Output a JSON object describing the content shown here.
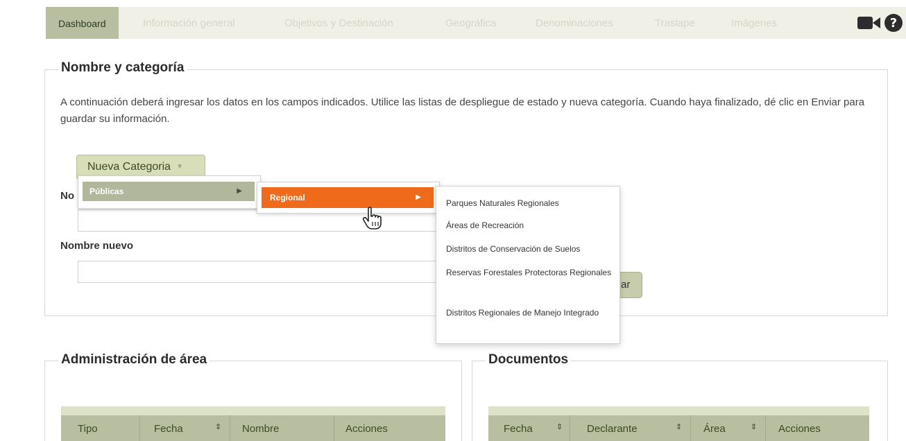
{
  "tabs": [
    {
      "label": "Dashboard",
      "active": true
    },
    {
      "label": "Información general",
      "active": false
    },
    {
      "label": "Objetivos y Destinación",
      "active": false
    },
    {
      "label": "Geográfica",
      "active": false
    },
    {
      "label": "Denominaciones",
      "active": false
    },
    {
      "label": "Traslape",
      "active": false
    },
    {
      "label": "Imágenes",
      "active": false
    }
  ],
  "toolbar": {
    "video_icon": "video-camera-icon",
    "help_icon": "help-circle-icon"
  },
  "nombre_categoria": {
    "legend": "Nombre y categoría",
    "description": "A continuación deberá ingresar los datos en los campos indicados. Utilice las listas de despliegue de estado y nueva categoría. Cuando haya finalizado, dé clic en Enviar para guardar su información.",
    "new_category_button": "Nueva Categoria",
    "nombre_label_partial": "No",
    "nombre_nuevo_label": "Nombre nuevo",
    "submit_partial": "ar"
  },
  "menu": {
    "level1": "Públicas",
    "level2": "Regional",
    "level3": [
      "Parques Naturales Regionales",
      "Áreas de Recreación",
      "Distritos de Conservación de Suelos",
      "Reservas Forestales Protectoras Regionales",
      "Distritos Regionales de Manejo Integrado"
    ]
  },
  "administracion": {
    "legend": "Administración de área",
    "columns": [
      "Tipo",
      "Fecha",
      "Nombre",
      "Acciones"
    ]
  },
  "documentos": {
    "legend": "Documentos",
    "columns": [
      "Fecha",
      "Declarante",
      "Área",
      "Acciones"
    ]
  },
  "colors": {
    "accent": "#f06a1c",
    "header_green": "#b8bfa0",
    "active_tab": "#b7bfa0"
  }
}
